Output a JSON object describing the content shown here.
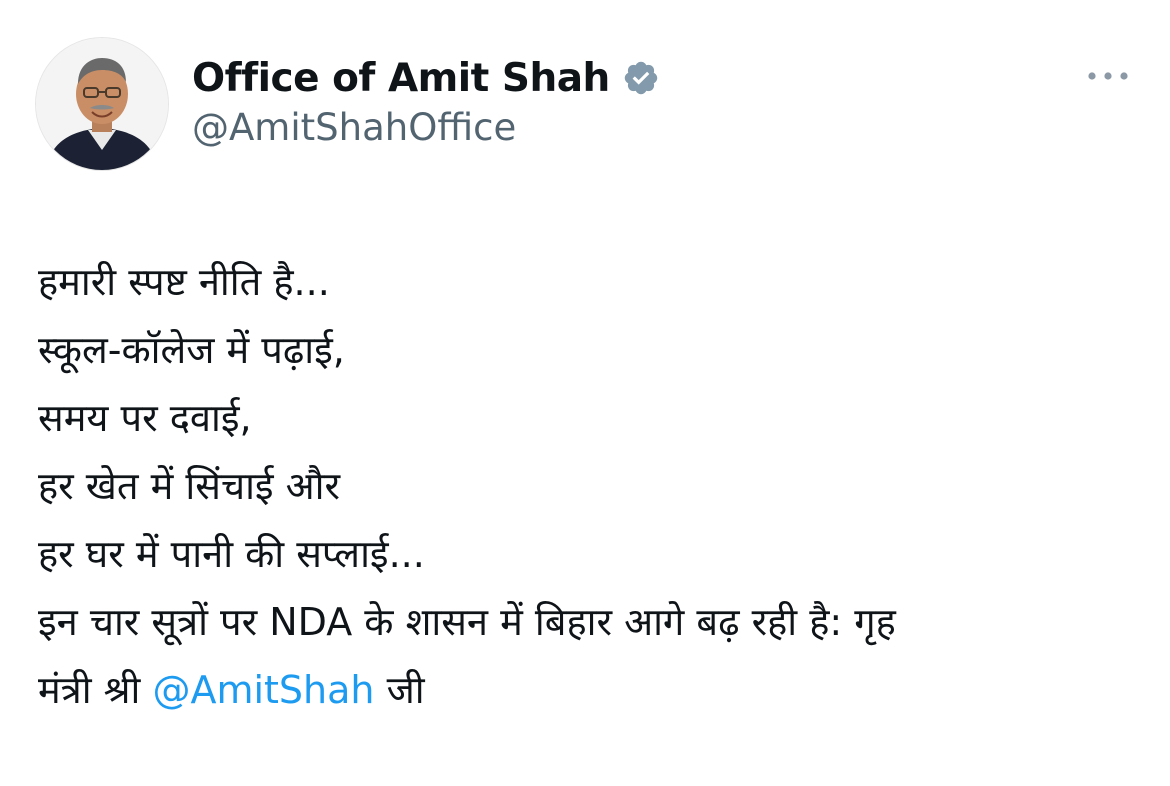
{
  "author": {
    "name": "Office of Amit Shah",
    "handle": "@AmitShahOffice",
    "verified_icon": "verified-badge-icon",
    "verified_color": "#829aab",
    "avatar_icon": "profile-photo"
  },
  "more_icon": "more-horizontal-icon",
  "tweet": {
    "lines": [
      "हमारी स्पष्ट नीति है...",
      "स्कूल-कॉलेज में पढ़ाई,",
      "समय पर दवाई,",
      "हर खेत में सिंचाई और",
      "हर घर में पानी की सप्लाई...",
      "इन चार सूत्रों पर NDA के शासन में बिहार आगे बढ़ रही है: गृह"
    ],
    "last_line_prefix": "मंत्री श्री ",
    "mention": "@AmitShah",
    "last_line_suffix": " जी"
  },
  "colors": {
    "text": "#0f1419",
    "secondary": "#536471",
    "link": "#1d9bf0"
  }
}
